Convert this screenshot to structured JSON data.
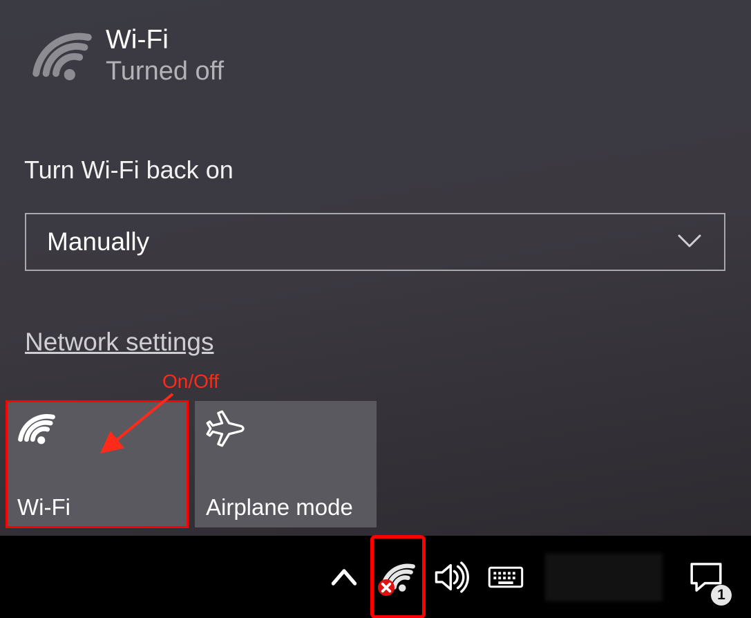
{
  "header": {
    "title": "Wi-Fi",
    "status": "Turned off"
  },
  "section_label": "Turn Wi-Fi back on",
  "dropdown": {
    "selected": "Manually"
  },
  "link": {
    "network_settings": "Network settings"
  },
  "tiles": {
    "wifi": "Wi-Fi",
    "airplane": "Airplane mode"
  },
  "annotation": {
    "label": "On/Off"
  },
  "tray": {
    "notif_count": "1"
  }
}
